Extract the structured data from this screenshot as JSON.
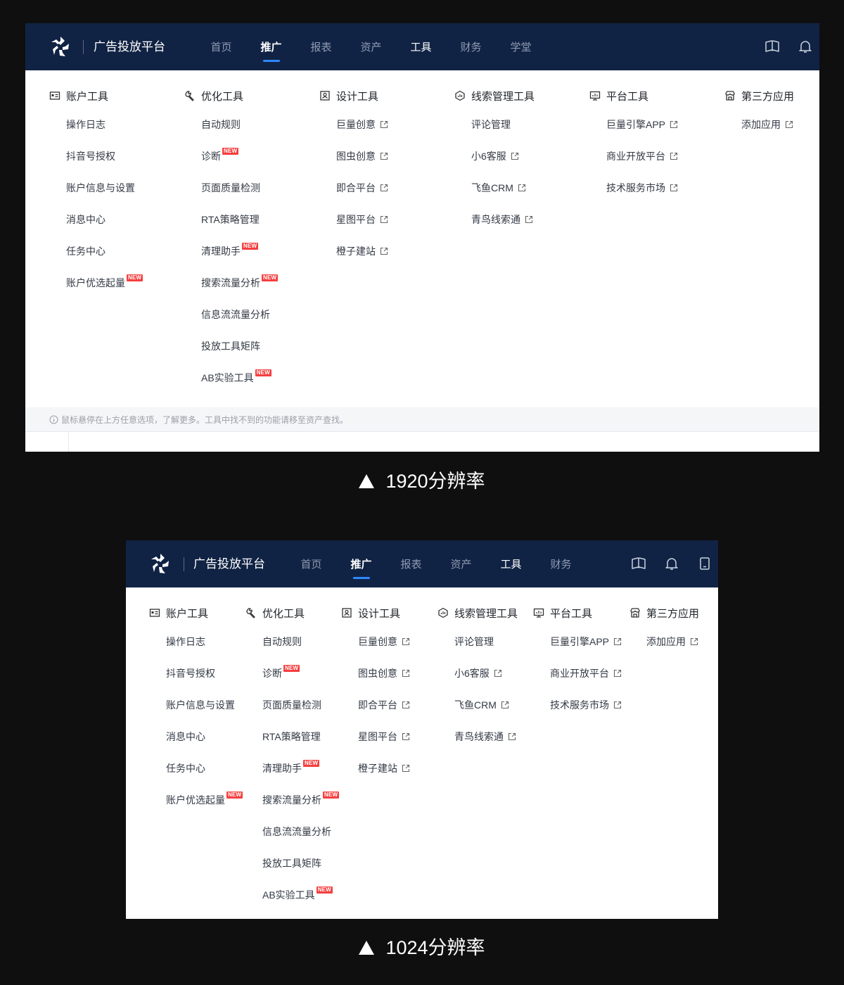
{
  "screens": [
    {
      "brand": "广告投放平台",
      "nav": [
        {
          "label": "首页",
          "state": "normal"
        },
        {
          "label": "推广",
          "state": "active"
        },
        {
          "label": "报表",
          "state": "normal"
        },
        {
          "label": "资产",
          "state": "normal"
        },
        {
          "label": "工具",
          "state": "strong"
        },
        {
          "label": "财务",
          "state": "normal"
        },
        {
          "label": "学堂",
          "state": "normal"
        }
      ],
      "top_icons": [
        "book-icon",
        "bell-icon"
      ],
      "columns": [
        {
          "title": "账户工具",
          "icon": "id-card-icon",
          "items": [
            {
              "label": "操作日志"
            },
            {
              "label": "抖音号授权"
            },
            {
              "label": "账户信息与设置"
            },
            {
              "label": "消息中心"
            },
            {
              "label": "任务中心"
            },
            {
              "label": "账户优选起量",
              "badge": "NEW"
            }
          ]
        },
        {
          "title": "优化工具",
          "icon": "wrench-icon",
          "items": [
            {
              "label": "自动规则"
            },
            {
              "label": "诊断",
              "badge": "NEW"
            },
            {
              "label": "页面质量检测"
            },
            {
              "label": "RTA策略管理"
            },
            {
              "label": "清理助手",
              "badge": "NEW"
            },
            {
              "label": "搜索流量分析",
              "badge": "NEW"
            },
            {
              "label": "信息流流量分析"
            },
            {
              "label": "投放工具矩阵"
            },
            {
              "label": "AB实验工具",
              "badge": "NEW"
            }
          ]
        },
        {
          "title": "设计工具",
          "icon": "design-icon",
          "items": [
            {
              "label": "巨量创意",
              "external": true
            },
            {
              "label": "图虫创意",
              "external": true
            },
            {
              "label": "即合平台",
              "external": true
            },
            {
              "label": "星图平台",
              "external": true
            },
            {
              "label": "橙子建站",
              "external": true
            }
          ]
        },
        {
          "title": "线索管理工具",
          "icon": "chart-hex-icon",
          "items": [
            {
              "label": "评论管理"
            },
            {
              "label": "小6客服",
              "external": true
            },
            {
              "label": "飞鱼CRM",
              "external": true
            },
            {
              "label": "青鸟线索通",
              "external": true
            }
          ]
        },
        {
          "title": "平台工具",
          "icon": "monitor-icon",
          "items": [
            {
              "label": "巨量引擎APP",
              "external": true
            },
            {
              "label": "商业开放平台",
              "external": true
            },
            {
              "label": "技术服务市场",
              "external": true
            }
          ]
        },
        {
          "title": "第三方应用",
          "icon": "store-icon",
          "items": [
            {
              "label": "添加应用",
              "external": true
            }
          ]
        }
      ],
      "footer_text": "鼠标悬停在上方任意选项，了解更多。工具中找不到的功能请移至资产查找。",
      "caption": "1920分辨率"
    },
    {
      "brand": "广告投放平台",
      "nav": [
        {
          "label": "首页",
          "state": "normal"
        },
        {
          "label": "推广",
          "state": "active"
        },
        {
          "label": "报表",
          "state": "normal"
        },
        {
          "label": "资产",
          "state": "normal"
        },
        {
          "label": "工具",
          "state": "strong"
        },
        {
          "label": "财务",
          "state": "normal"
        }
      ],
      "top_icons": [
        "book-icon",
        "bell-icon",
        "tablet-icon"
      ],
      "columns": [
        {
          "title": "账户工具",
          "icon": "id-card-icon",
          "items": [
            {
              "label": "操作日志"
            },
            {
              "label": "抖音号授权"
            },
            {
              "label": "账户信息与设置"
            },
            {
              "label": "消息中心"
            },
            {
              "label": "任务中心"
            },
            {
              "label": "账户优选起量",
              "badge": "NEW"
            }
          ]
        },
        {
          "title": "优化工具",
          "icon": "wrench-icon",
          "items": [
            {
              "label": "自动规则"
            },
            {
              "label": "诊断",
              "badge": "NEW"
            },
            {
              "label": "页面质量检测"
            },
            {
              "label": "RTA策略管理"
            },
            {
              "label": "清理助手",
              "badge": "NEW"
            },
            {
              "label": "搜索流量分析",
              "badge": "NEW"
            },
            {
              "label": "信息流流量分析"
            },
            {
              "label": "投放工具矩阵"
            },
            {
              "label": "AB实验工具",
              "badge": "NEW"
            }
          ]
        },
        {
          "title": "设计工具",
          "icon": "design-icon",
          "items": [
            {
              "label": "巨量创意",
              "external": true
            },
            {
              "label": "图虫创意",
              "external": true
            },
            {
              "label": "即合平台",
              "external": true
            },
            {
              "label": "星图平台",
              "external": true
            },
            {
              "label": "橙子建站",
              "external": true
            }
          ]
        },
        {
          "title": "线索管理工具",
          "icon": "chart-hex-icon",
          "items": [
            {
              "label": "评论管理"
            },
            {
              "label": "小6客服",
              "external": true
            },
            {
              "label": "飞鱼CRM",
              "external": true
            },
            {
              "label": "青鸟线索通",
              "external": true
            }
          ]
        },
        {
          "title": "平台工具",
          "icon": "monitor-icon",
          "items": [
            {
              "label": "巨量引擎APP",
              "external": true
            },
            {
              "label": "商业开放平台",
              "external": true
            },
            {
              "label": "技术服务市场",
              "external": true
            }
          ]
        },
        {
          "title": "第三方应用",
          "icon": "store-icon",
          "items": [
            {
              "label": "添加应用",
              "external": true
            }
          ]
        }
      ],
      "caption": "1024分辨率"
    }
  ]
}
